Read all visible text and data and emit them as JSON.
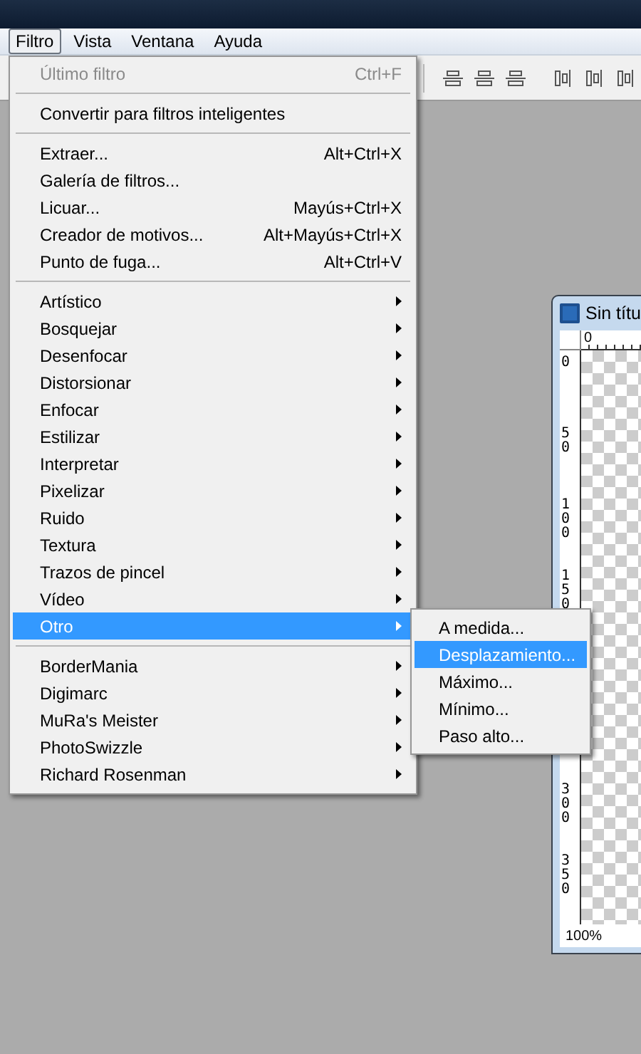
{
  "menubar": [
    {
      "label": "Filtro",
      "selected": true
    },
    {
      "label": "Vista",
      "selected": false
    },
    {
      "label": "Ventana",
      "selected": false
    },
    {
      "label": "Ayuda",
      "selected": false
    }
  ],
  "document": {
    "title": "Sin títu",
    "top_ruler": "0",
    "left_ruler": [
      "0",
      "50",
      "100",
      "150",
      "300",
      "350"
    ],
    "zoom": "100%"
  },
  "filter_menu": {
    "sections": [
      [
        {
          "label": "Último filtro",
          "shortcut": "Ctrl+F",
          "disabled": true,
          "submenu": false,
          "selected": false
        }
      ],
      [
        {
          "label": "Convertir para filtros inteligentes",
          "disabled": false,
          "submenu": false,
          "selected": false
        }
      ],
      [
        {
          "label": "Extraer...",
          "shortcut": "Alt+Ctrl+X",
          "disabled": false,
          "submenu": false,
          "selected": false
        },
        {
          "label": "Galería de filtros...",
          "disabled": false,
          "submenu": false,
          "selected": false
        },
        {
          "label": "Licuar...",
          "shortcut": "Mayús+Ctrl+X",
          "disabled": false,
          "submenu": false,
          "selected": false
        },
        {
          "label": "Creador de motivos...",
          "shortcut": "Alt+Mayús+Ctrl+X",
          "disabled": false,
          "submenu": false,
          "selected": false
        },
        {
          "label": "Punto de fuga...",
          "shortcut": "Alt+Ctrl+V",
          "disabled": false,
          "submenu": false,
          "selected": false
        }
      ],
      [
        {
          "label": "Artístico",
          "disabled": false,
          "submenu": true,
          "selected": false
        },
        {
          "label": "Bosquejar",
          "disabled": false,
          "submenu": true,
          "selected": false
        },
        {
          "label": "Desenfocar",
          "disabled": false,
          "submenu": true,
          "selected": false
        },
        {
          "label": "Distorsionar",
          "disabled": false,
          "submenu": true,
          "selected": false
        },
        {
          "label": "Enfocar",
          "disabled": false,
          "submenu": true,
          "selected": false
        },
        {
          "label": "Estilizar",
          "disabled": false,
          "submenu": true,
          "selected": false
        },
        {
          "label": "Interpretar",
          "disabled": false,
          "submenu": true,
          "selected": false
        },
        {
          "label": "Pixelizar",
          "disabled": false,
          "submenu": true,
          "selected": false
        },
        {
          "label": "Ruido",
          "disabled": false,
          "submenu": true,
          "selected": false
        },
        {
          "label": "Textura",
          "disabled": false,
          "submenu": true,
          "selected": false
        },
        {
          "label": "Trazos de pincel",
          "disabled": false,
          "submenu": true,
          "selected": false
        },
        {
          "label": "Vídeo",
          "disabled": false,
          "submenu": true,
          "selected": false
        },
        {
          "label": "Otro",
          "disabled": false,
          "submenu": true,
          "selected": true
        }
      ],
      [
        {
          "label": "BorderMania",
          "disabled": false,
          "submenu": true,
          "selected": false
        },
        {
          "label": "Digimarc",
          "disabled": false,
          "submenu": true,
          "selected": false
        },
        {
          "label": "MuRa's Meister",
          "disabled": false,
          "submenu": true,
          "selected": false
        },
        {
          "label": "PhotoSwizzle",
          "disabled": false,
          "submenu": true,
          "selected": false
        },
        {
          "label": "Richard Rosenman",
          "disabled": false,
          "submenu": true,
          "selected": false
        }
      ]
    ]
  },
  "other_submenu": [
    {
      "label": "A medida...",
      "selected": false
    },
    {
      "label": "Desplazamiento...",
      "selected": true
    },
    {
      "label": "Máximo...",
      "selected": false
    },
    {
      "label": "Mínimo...",
      "selected": false
    },
    {
      "label": "Paso alto...",
      "selected": false
    }
  ]
}
